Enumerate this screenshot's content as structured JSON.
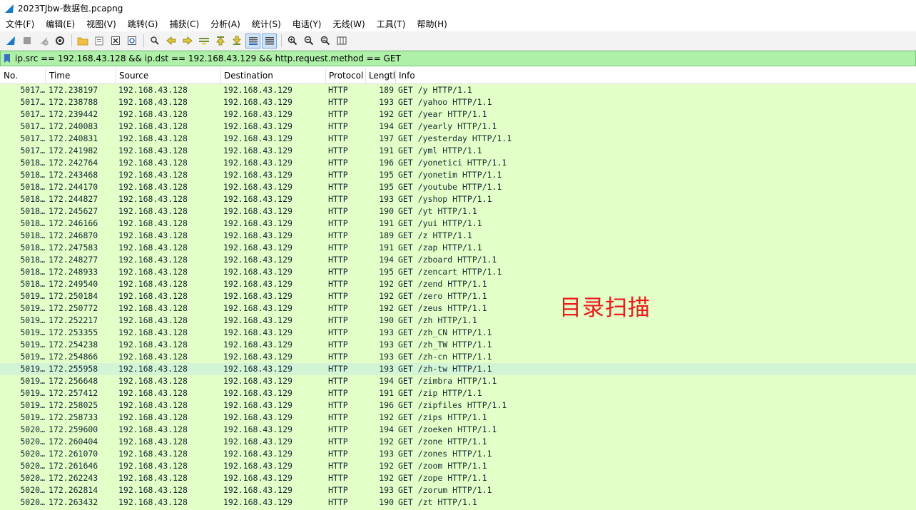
{
  "window": {
    "title": "2023TJbw-数据包.pcapng"
  },
  "menu": [
    {
      "label": "文件(F)"
    },
    {
      "label": "编辑(E)"
    },
    {
      "label": "视图(V)"
    },
    {
      "label": "跳转(G)"
    },
    {
      "label": "捕获(C)"
    },
    {
      "label": "分析(A)"
    },
    {
      "label": "统计(S)"
    },
    {
      "label": "电话(Y)"
    },
    {
      "label": "无线(W)"
    },
    {
      "label": "工具(T)"
    },
    {
      "label": "帮助(H)"
    }
  ],
  "toolbar": {
    "icons": [
      "shark-fin-icon",
      "stop-icon",
      "restart-icon",
      "options-gear-icon",
      "open-folder-icon",
      "file-set-icon",
      "close-file-icon",
      "reload-icon",
      "find-icon",
      "back-arrow-icon",
      "forward-arrow-icon",
      "go-to-packet-icon",
      "first-packet-icon",
      "last-packet-icon",
      "autoscroll-icon",
      "colorize-icon",
      "zoom-in-icon",
      "zoom-out-icon",
      "normal-size-icon",
      "resize-columns-icon"
    ]
  },
  "filter": {
    "value": "ip.src == 192.168.43.128 && ip.dst == 192.168.43.129 && http.request.method == GET"
  },
  "columns": [
    "No.",
    "Time",
    "Source",
    "Destination",
    "Protocol",
    "Lengtl",
    "Info"
  ],
  "packets": [
    {
      "no": "5017…",
      "time": "172.238197",
      "src": "192.168.43.128",
      "dst": "192.168.43.129",
      "proto": "HTTP",
      "len": "189",
      "info": "GET /y HTTP/1.1"
    },
    {
      "no": "5017…",
      "time": "172.238788",
      "src": "192.168.43.128",
      "dst": "192.168.43.129",
      "proto": "HTTP",
      "len": "193",
      "info": "GET /yahoo HTTP/1.1"
    },
    {
      "no": "5017…",
      "time": "172.239442",
      "src": "192.168.43.128",
      "dst": "192.168.43.129",
      "proto": "HTTP",
      "len": "192",
      "info": "GET /year HTTP/1.1"
    },
    {
      "no": "5017…",
      "time": "172.240083",
      "src": "192.168.43.128",
      "dst": "192.168.43.129",
      "proto": "HTTP",
      "len": "194",
      "info": "GET /yearly HTTP/1.1"
    },
    {
      "no": "5017…",
      "time": "172.240831",
      "src": "192.168.43.128",
      "dst": "192.168.43.129",
      "proto": "HTTP",
      "len": "197",
      "info": "GET /yesterday HTTP/1.1"
    },
    {
      "no": "5017…",
      "time": "172.241982",
      "src": "192.168.43.128",
      "dst": "192.168.43.129",
      "proto": "HTTP",
      "len": "191",
      "info": "GET /yml HTTP/1.1"
    },
    {
      "no": "5018…",
      "time": "172.242764",
      "src": "192.168.43.128",
      "dst": "192.168.43.129",
      "proto": "HTTP",
      "len": "196",
      "info": "GET /yonetici HTTP/1.1"
    },
    {
      "no": "5018…",
      "time": "172.243468",
      "src": "192.168.43.128",
      "dst": "192.168.43.129",
      "proto": "HTTP",
      "len": "195",
      "info": "GET /yonetim HTTP/1.1"
    },
    {
      "no": "5018…",
      "time": "172.244170",
      "src": "192.168.43.128",
      "dst": "192.168.43.129",
      "proto": "HTTP",
      "len": "195",
      "info": "GET /youtube HTTP/1.1"
    },
    {
      "no": "5018…",
      "time": "172.244827",
      "src": "192.168.43.128",
      "dst": "192.168.43.129",
      "proto": "HTTP",
      "len": "193",
      "info": "GET /yshop HTTP/1.1"
    },
    {
      "no": "5018…",
      "time": "172.245627",
      "src": "192.168.43.128",
      "dst": "192.168.43.129",
      "proto": "HTTP",
      "len": "190",
      "info": "GET /yt HTTP/1.1"
    },
    {
      "no": "5018…",
      "time": "172.246166",
      "src": "192.168.43.128",
      "dst": "192.168.43.129",
      "proto": "HTTP",
      "len": "191",
      "info": "GET /yui HTTP/1.1"
    },
    {
      "no": "5018…",
      "time": "172.246870",
      "src": "192.168.43.128",
      "dst": "192.168.43.129",
      "proto": "HTTP",
      "len": "189",
      "info": "GET /z HTTP/1.1"
    },
    {
      "no": "5018…",
      "time": "172.247583",
      "src": "192.168.43.128",
      "dst": "192.168.43.129",
      "proto": "HTTP",
      "len": "191",
      "info": "GET /zap HTTP/1.1"
    },
    {
      "no": "5018…",
      "time": "172.248277",
      "src": "192.168.43.128",
      "dst": "192.168.43.129",
      "proto": "HTTP",
      "len": "194",
      "info": "GET /zboard HTTP/1.1"
    },
    {
      "no": "5018…",
      "time": "172.248933",
      "src": "192.168.43.128",
      "dst": "192.168.43.129",
      "proto": "HTTP",
      "len": "195",
      "info": "GET /zencart HTTP/1.1"
    },
    {
      "no": "5018…",
      "time": "172.249540",
      "src": "192.168.43.128",
      "dst": "192.168.43.129",
      "proto": "HTTP",
      "len": "192",
      "info": "GET /zend HTTP/1.1"
    },
    {
      "no": "5019…",
      "time": "172.250184",
      "src": "192.168.43.128",
      "dst": "192.168.43.129",
      "proto": "HTTP",
      "len": "192",
      "info": "GET /zero HTTP/1.1"
    },
    {
      "no": "5019…",
      "time": "172.250772",
      "src": "192.168.43.128",
      "dst": "192.168.43.129",
      "proto": "HTTP",
      "len": "192",
      "info": "GET /zeus HTTP/1.1"
    },
    {
      "no": "5019…",
      "time": "172.252217",
      "src": "192.168.43.128",
      "dst": "192.168.43.129",
      "proto": "HTTP",
      "len": "190",
      "info": "GET /zh HTTP/1.1"
    },
    {
      "no": "5019…",
      "time": "172.253355",
      "src": "192.168.43.128",
      "dst": "192.168.43.129",
      "proto": "HTTP",
      "len": "193",
      "info": "GET /zh_CN HTTP/1.1"
    },
    {
      "no": "5019…",
      "time": "172.254238",
      "src": "192.168.43.128",
      "dst": "192.168.43.129",
      "proto": "HTTP",
      "len": "193",
      "info": "GET /zh_TW HTTP/1.1"
    },
    {
      "no": "5019…",
      "time": "172.254866",
      "src": "192.168.43.128",
      "dst": "192.168.43.129",
      "proto": "HTTP",
      "len": "193",
      "info": "GET /zh-cn HTTP/1.1"
    },
    {
      "no": "5019…",
      "time": "172.255958",
      "src": "192.168.43.128",
      "dst": "192.168.43.129",
      "proto": "HTTP",
      "len": "193",
      "info": "GET /zh-tw HTTP/1.1",
      "selected": true
    },
    {
      "no": "5019…",
      "time": "172.256648",
      "src": "192.168.43.128",
      "dst": "192.168.43.129",
      "proto": "HTTP",
      "len": "194",
      "info": "GET /zimbra HTTP/1.1"
    },
    {
      "no": "5019…",
      "time": "172.257412",
      "src": "192.168.43.128",
      "dst": "192.168.43.129",
      "proto": "HTTP",
      "len": "191",
      "info": "GET /zip HTTP/1.1"
    },
    {
      "no": "5019…",
      "time": "172.258025",
      "src": "192.168.43.128",
      "dst": "192.168.43.129",
      "proto": "HTTP",
      "len": "196",
      "info": "GET /zipfiles HTTP/1.1"
    },
    {
      "no": "5019…",
      "time": "172.258733",
      "src": "192.168.43.128",
      "dst": "192.168.43.129",
      "proto": "HTTP",
      "len": "192",
      "info": "GET /zips HTTP/1.1"
    },
    {
      "no": "5020…",
      "time": "172.259600",
      "src": "192.168.43.128",
      "dst": "192.168.43.129",
      "proto": "HTTP",
      "len": "194",
      "info": "GET /zoeken HTTP/1.1"
    },
    {
      "no": "5020…",
      "time": "172.260404",
      "src": "192.168.43.128",
      "dst": "192.168.43.129",
      "proto": "HTTP",
      "len": "192",
      "info": "GET /zone HTTP/1.1"
    },
    {
      "no": "5020…",
      "time": "172.261070",
      "src": "192.168.43.128",
      "dst": "192.168.43.129",
      "proto": "HTTP",
      "len": "193",
      "info": "GET /zones HTTP/1.1"
    },
    {
      "no": "5020…",
      "time": "172.261646",
      "src": "192.168.43.128",
      "dst": "192.168.43.129",
      "proto": "HTTP",
      "len": "192",
      "info": "GET /zoom HTTP/1.1"
    },
    {
      "no": "5020…",
      "time": "172.262243",
      "src": "192.168.43.128",
      "dst": "192.168.43.129",
      "proto": "HTTP",
      "len": "192",
      "info": "GET /zope HTTP/1.1"
    },
    {
      "no": "5020…",
      "time": "172.262814",
      "src": "192.168.43.128",
      "dst": "192.168.43.129",
      "proto": "HTTP",
      "len": "193",
      "info": "GET /zorum HTTP/1.1"
    },
    {
      "no": "5020…",
      "time": "172.263432",
      "src": "192.168.43.128",
      "dst": "192.168.43.129",
      "proto": "HTTP",
      "len": "190",
      "info": "GET /zt HTTP/1.1"
    }
  ],
  "annotation": {
    "text": "目录扫描",
    "color": "#ee1b1b"
  },
  "colors": {
    "row_bg": "#e4ffc7",
    "selected_row_bg": "#d3f5d6",
    "filter_bg": "#aef0a8"
  }
}
